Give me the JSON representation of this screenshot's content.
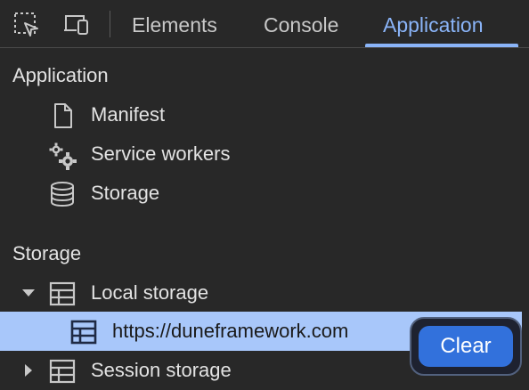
{
  "toolbar": {
    "tabs": [
      {
        "label": "Elements"
      },
      {
        "label": "Console"
      },
      {
        "label": "Application"
      }
    ],
    "active_tab": "Application",
    "icons": [
      "inspect-element-icon",
      "device-toggle-icon"
    ]
  },
  "sidebar": {
    "application_header": "Application",
    "application_items": [
      {
        "label": "Manifest",
        "icon": "document-icon"
      },
      {
        "label": "Service workers",
        "icon": "gears-icon"
      },
      {
        "label": "Storage",
        "icon": "database-icon"
      }
    ],
    "storage_header": "Storage",
    "storage_items": [
      {
        "label": "Local storage",
        "icon": "table-icon",
        "expanded": true
      },
      {
        "label": "https://duneframework.com",
        "icon": "table-icon",
        "selected": true
      },
      {
        "label": "Session storage",
        "icon": "table-icon",
        "expanded": false
      }
    ]
  },
  "popup": {
    "clear_label": "Clear"
  },
  "colors": {
    "background": "#282828",
    "accent": "#8ab4f8",
    "selected_row": "#a8c7fa",
    "button": "#3271dc"
  }
}
